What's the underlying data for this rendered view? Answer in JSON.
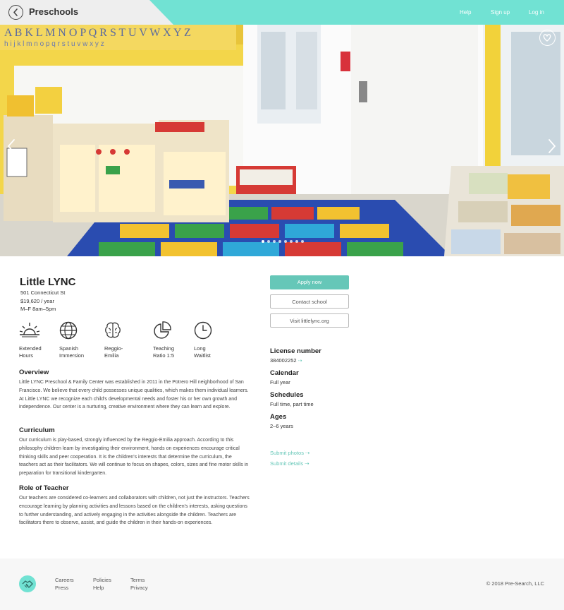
{
  "header": {
    "title": "Preschools",
    "nav": [
      "Help",
      "Sign up",
      "Log in"
    ]
  },
  "hero": {
    "slide_count": 8,
    "active_slide": 0
  },
  "school": {
    "name": "Little LYNC",
    "address": "501 Connecticut St",
    "tuition": "$19,620 / year",
    "hours": "M–F 8am–5pm"
  },
  "features": [
    {
      "icon": "sunrise-icon",
      "line1": "Extended",
      "line2": "Hours"
    },
    {
      "icon": "globe-icon",
      "line1": "Spanish",
      "line2": "Immersion"
    },
    {
      "icon": "brain-icon",
      "line1": "Reggio-",
      "line2": "Emilia"
    },
    {
      "icon": "pie-chart-icon",
      "line1": "Teaching",
      "line2": "Ratio 1:5"
    },
    {
      "icon": "clock-icon",
      "line1": "Long",
      "line2": "Waitlist"
    }
  ],
  "sections": {
    "overview": {
      "title": "Overview",
      "body": "Little LYNC Preschool & Family Center was established in 2011 in the Potrero Hill neighborhood of San Francisco. We believe that every child possesses unique qualities, which makes them individual learners.  At Little LYNC we recognize each child's developmental needs and foster his or her own growth and independence. Our center is a nurturing, creative environment where they can learn and explore."
    },
    "curriculum": {
      "title": "Curriculum",
      "body": "Our curriculum is play-based, strongly influenced by the Reggio-Emilia approach. According to this philosophy children learn by investigating their environment, hands on experiences encourage critical thinking skills and peer cooperation. It is the children's interests that determine the curriculum, the teachers act as their facilitators.  We will continue to focus on shapes, colors, sizes and fine motor skills in preparation for transitional kindergarten."
    },
    "role": {
      "title": "Role of Teacher",
      "body": "Our teachers are considered co-learners and collaborators with children, not just the instructors. Teachers encourage learning by planning activities and lessons based on the children's interests, asking questions to further understanding, and actively engaging in the activities alongside the children. Teachers are facilitators there to observe, assist, and guide the children in their hands-on experiences."
    }
  },
  "actions": {
    "apply": "Apply now",
    "contact": "Contact school",
    "visit": "Visit littlelync.org"
  },
  "info": {
    "license_title": "License number",
    "license_value": "384002252",
    "calendar_title": "Calendar",
    "calendar_value": "Full year",
    "schedules_title": "Schedules",
    "schedules_value": "Full time, part time",
    "ages_title": "Ages",
    "ages_value": "2–6 years",
    "submit_photos": "Submit photos",
    "submit_details": "Submit details",
    "arrow": "⇢"
  },
  "footer": {
    "col1": [
      "Careers",
      "Press"
    ],
    "col2": [
      "Policies",
      "Help"
    ],
    "col3": [
      "Terms",
      "Privacy"
    ],
    "copyright": "© 2018 Pre-Search, LLC"
  },
  "colors": {
    "accent": "#71e2d3",
    "button": "#66c7b8"
  }
}
